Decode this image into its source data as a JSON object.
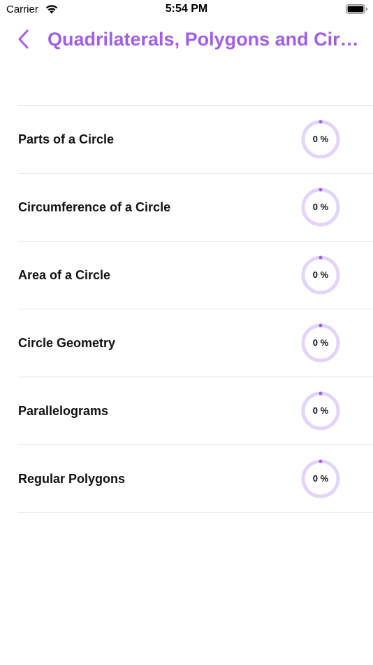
{
  "status_bar": {
    "carrier": "Carrier",
    "time": "5:54 PM"
  },
  "nav": {
    "title": "Quadrilaterals, Polygons and Circles",
    "back_icon": "chevron-left-icon"
  },
  "colors": {
    "accent": "#a15ee8",
    "ring": "#e3d5fa",
    "separator": "#e3e3e6"
  },
  "topics": [
    {
      "label": "Parts of a Circle",
      "progress_text": "0 %",
      "progress": 0
    },
    {
      "label": "Circumference of a Circle",
      "progress_text": "0 %",
      "progress": 0
    },
    {
      "label": "Area of a Circle",
      "progress_text": "0 %",
      "progress": 0
    },
    {
      "label": "Circle Geometry",
      "progress_text": "0 %",
      "progress": 0
    },
    {
      "label": "Parallelograms",
      "progress_text": "0 %",
      "progress": 0
    },
    {
      "label": "Regular Polygons",
      "progress_text": "0 %",
      "progress": 0
    }
  ]
}
